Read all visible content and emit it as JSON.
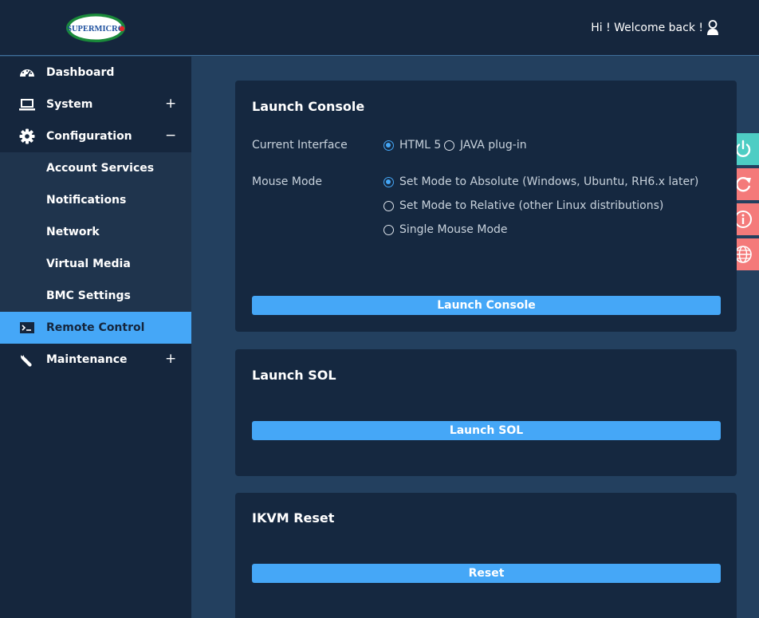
{
  "header": {
    "logo_text": "SUPERMICRO",
    "welcome": "Hi ! Welcome back !"
  },
  "sidebar": {
    "items": [
      {
        "label": "Dashboard",
        "icon": "speedometer-icon"
      },
      {
        "label": "System",
        "icon": "laptop-icon",
        "toggle": "+"
      },
      {
        "label": "Configuration",
        "icon": "gear-icon",
        "toggle": "−"
      },
      {
        "label": "Account Services"
      },
      {
        "label": "Notifications"
      },
      {
        "label": "Network"
      },
      {
        "label": "Virtual Media"
      },
      {
        "label": "BMC Settings"
      },
      {
        "label": "Remote Control",
        "icon": "terminal-icon",
        "active": true
      },
      {
        "label": "Maintenance",
        "icon": "wrench-icon",
        "toggle": "+"
      }
    ]
  },
  "side_buttons": [
    {
      "icon": "power-icon",
      "color": "#4ecdc4"
    },
    {
      "icon": "refresh-icon",
      "color": "#f47a7a"
    },
    {
      "icon": "info-icon",
      "color": "#f47a7a"
    },
    {
      "icon": "globe-icon",
      "color": "#f47a7a"
    }
  ],
  "console": {
    "title": "Launch Console",
    "interface_label": "Current Interface",
    "interface_options": [
      "HTML 5",
      "JAVA plug-in"
    ],
    "interface_selected": "HTML 5",
    "mouse_label": "Mouse Mode",
    "mouse_options": [
      "Set Mode to Absolute (Windows, Ubuntu, RH6.x later)",
      "Set Mode to Relative (other Linux distributions)",
      "Single Mouse Mode"
    ],
    "mouse_selected": "Set Mode to Absolute (Windows, Ubuntu, RH6.x later)",
    "button": "Launch Console"
  },
  "sol": {
    "title": "Launch SOL",
    "button": "Launch SOL"
  },
  "ikvm": {
    "title": "IKVM Reset",
    "button": "Reset"
  }
}
